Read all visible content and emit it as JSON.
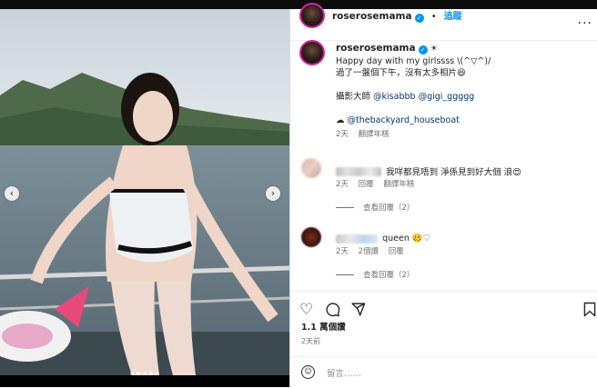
{
  "header": {
    "username": "roserosemama",
    "follow_label": "追蹤",
    "more_icon": "more-dots-icon"
  },
  "caption": {
    "username": "roserosemama",
    "line1": "Happy day with my girlssss \\(^▽^)/",
    "line2": "過了一盤個下午，沒有太多相片😆",
    "line3_prefix": "攝影大師 ",
    "mention1": "@kisabbb",
    "mention2": "@gigi_ggggg",
    "line4_prefix": "☁ ",
    "mention3": "@thebackyard_houseboat",
    "time": "2天",
    "translate": "翻譯年糕"
  },
  "comments": [
    {
      "text": "我咩都見唔到 淨係見到好大個 浪😍",
      "time": "2天",
      "reply": "回覆",
      "translate": "翻譯年糕",
      "view_replies": "查看回覆（2）"
    },
    {
      "text": "queen 🥴♡",
      "time": "2天",
      "likes": "2個讚",
      "reply": "回覆",
      "view_replies": "查看回覆（2）"
    }
  ],
  "post": {
    "likes": "1.1 萬個讚",
    "ago": "2天前",
    "comment_placeholder": "留言……",
    "carousel": {
      "count": 5,
      "active": 1
    }
  },
  "colors": {
    "accent": "#0095f6",
    "text": "#262626",
    "muted": "#737373",
    "mention": "#00376b"
  }
}
